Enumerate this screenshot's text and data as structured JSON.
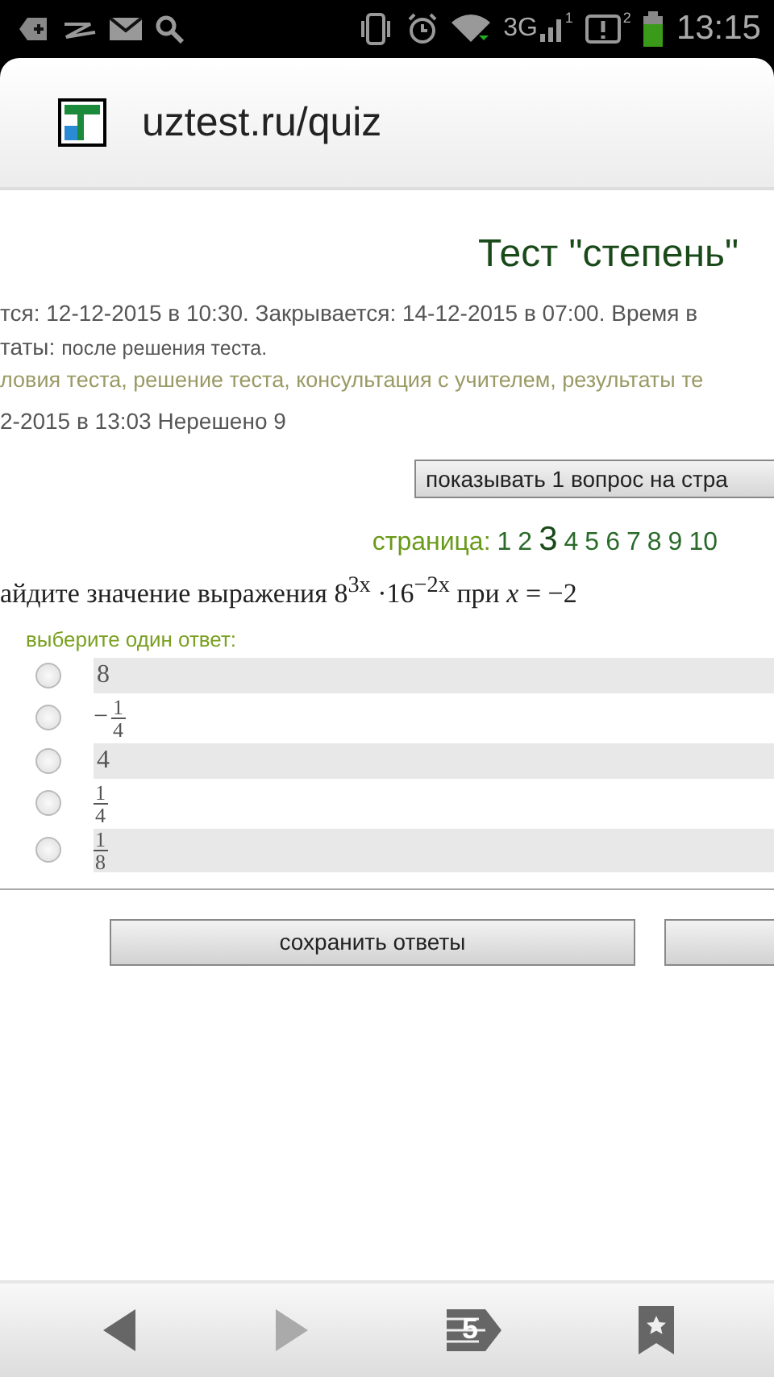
{
  "status_bar": {
    "network": "3G",
    "sim_1": "1",
    "sim_2": "2",
    "time": "13:15"
  },
  "browser": {
    "url": "uztest.ru/quiz"
  },
  "page": {
    "title": "Тест \"степень\"",
    "info_lines": [
      {
        "kind": "plain",
        "text": "тся: 12-12-2015 в 10:30. Закрывается: 14-12-2015 в 07:00. Время в"
      },
      {
        "kind": "mixed",
        "label": "таты:",
        "text": "после решения теста."
      },
      {
        "kind": "links",
        "text": "ловия теста, решение теста, консультация с учителем, результаты те"
      },
      {
        "kind": "plain",
        "text": "2-2015 в 13:03    Нерешено 9"
      }
    ],
    "mode_button": "показывать 1 вопрос на стра",
    "pagination": {
      "label": "страница:",
      "pages": [
        {
          "label": "1",
          "selected": false
        },
        {
          "label": "2",
          "selected": false
        },
        {
          "label": "3",
          "selected": true
        },
        {
          "label": "4",
          "selected": false
        },
        {
          "label": "5",
          "selected": false
        },
        {
          "label": "6",
          "selected": false
        },
        {
          "label": "7",
          "selected": false
        },
        {
          "label": "8",
          "selected": false
        },
        {
          "label": "9",
          "selected": false
        },
        {
          "label": "10",
          "selected": false
        }
      ]
    },
    "question": "айдите значение выражения 8$^{3x}$ ·16$^{−2x}$  при *x* = −2",
    "answer_hint": "выберите один ответ:",
    "options": [
      {
        "kind": "number",
        "text": "8",
        "selected": false
      },
      {
        "kind": "fraction",
        "sign": "−",
        "numerator": "1",
        "denominator": "4",
        "selected": false
      },
      {
        "kind": "number",
        "text": "4",
        "selected": false
      },
      {
        "kind": "fraction",
        "numerator": "1",
        "denominator": "4",
        "selected": false
      },
      {
        "kind": "fraction",
        "numerator": "1",
        "denominator": "8",
        "selected": false
      }
    ],
    "save_button": "сохранить ответы"
  },
  "bottom_bar": {
    "tab_count": "5",
    "forward_disabled": true
  }
}
